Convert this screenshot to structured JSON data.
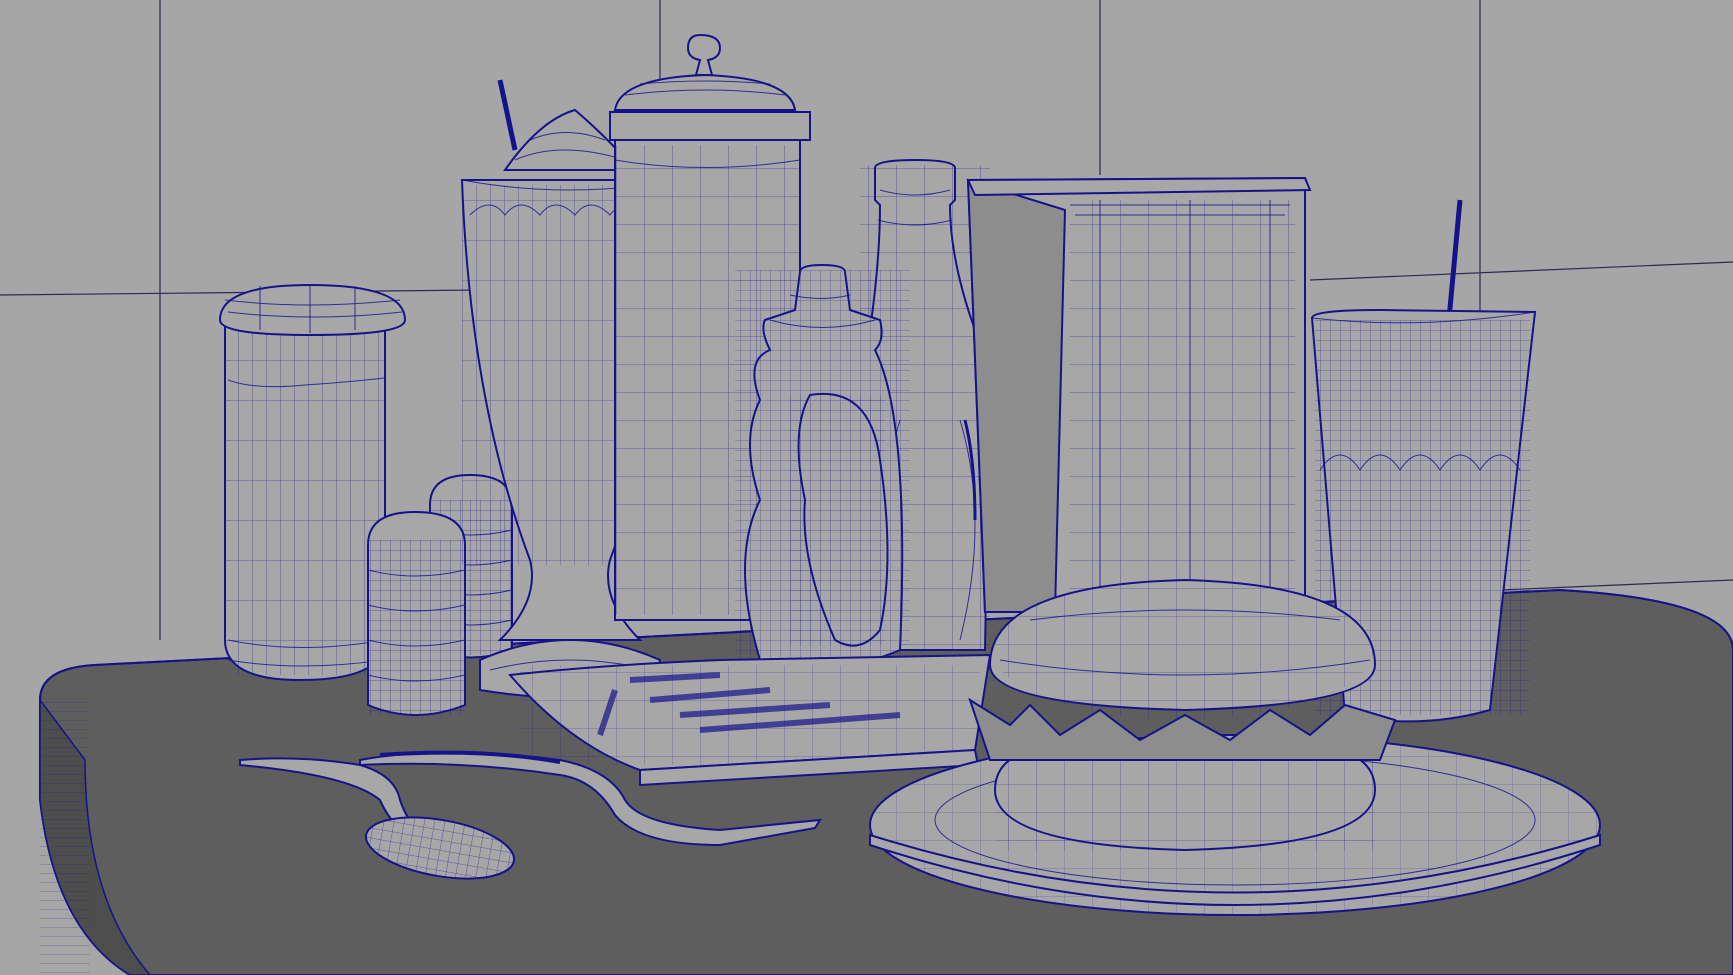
{
  "viewport": {
    "background_wall": "#a6a6a6",
    "table_top": "#5e5e5e",
    "table_edge": "#4d4d4d",
    "wireframe_color": "#15138a",
    "shaded_surface": "#a7a7a7"
  },
  "scene_objects": [
    "sugar-dispenser",
    "salt-shaker",
    "pepper-shaker",
    "milkshake-glass",
    "tall-canister",
    "mustard-bottle",
    "ketchup-bottle",
    "napkin-holder",
    "soda-glass",
    "fries-tray",
    "burger",
    "plate",
    "spoon",
    "fork"
  ]
}
